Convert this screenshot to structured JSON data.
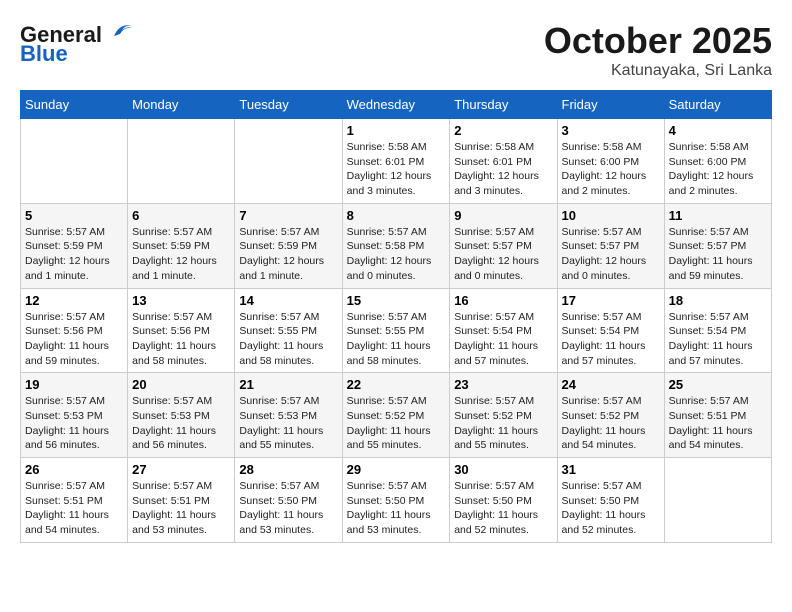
{
  "header": {
    "logo_general": "General",
    "logo_blue": "Blue",
    "month": "October 2025",
    "location": "Katunayaka, Sri Lanka"
  },
  "weekdays": [
    "Sunday",
    "Monday",
    "Tuesday",
    "Wednesday",
    "Thursday",
    "Friday",
    "Saturday"
  ],
  "weeks": [
    [
      {
        "day": "",
        "info": ""
      },
      {
        "day": "",
        "info": ""
      },
      {
        "day": "",
        "info": ""
      },
      {
        "day": "1",
        "info": "Sunrise: 5:58 AM\nSunset: 6:01 PM\nDaylight: 12 hours\nand 3 minutes."
      },
      {
        "day": "2",
        "info": "Sunrise: 5:58 AM\nSunset: 6:01 PM\nDaylight: 12 hours\nand 3 minutes."
      },
      {
        "day": "3",
        "info": "Sunrise: 5:58 AM\nSunset: 6:00 PM\nDaylight: 12 hours\nand 2 minutes."
      },
      {
        "day": "4",
        "info": "Sunrise: 5:58 AM\nSunset: 6:00 PM\nDaylight: 12 hours\nand 2 minutes."
      }
    ],
    [
      {
        "day": "5",
        "info": "Sunrise: 5:57 AM\nSunset: 5:59 PM\nDaylight: 12 hours\nand 1 minute."
      },
      {
        "day": "6",
        "info": "Sunrise: 5:57 AM\nSunset: 5:59 PM\nDaylight: 12 hours\nand 1 minute."
      },
      {
        "day": "7",
        "info": "Sunrise: 5:57 AM\nSunset: 5:59 PM\nDaylight: 12 hours\nand 1 minute."
      },
      {
        "day": "8",
        "info": "Sunrise: 5:57 AM\nSunset: 5:58 PM\nDaylight: 12 hours\nand 0 minutes."
      },
      {
        "day": "9",
        "info": "Sunrise: 5:57 AM\nSunset: 5:57 PM\nDaylight: 12 hours\nand 0 minutes."
      },
      {
        "day": "10",
        "info": "Sunrise: 5:57 AM\nSunset: 5:57 PM\nDaylight: 12 hours\nand 0 minutes."
      },
      {
        "day": "11",
        "info": "Sunrise: 5:57 AM\nSunset: 5:57 PM\nDaylight: 11 hours\nand 59 minutes."
      }
    ],
    [
      {
        "day": "12",
        "info": "Sunrise: 5:57 AM\nSunset: 5:56 PM\nDaylight: 11 hours\nand 59 minutes."
      },
      {
        "day": "13",
        "info": "Sunrise: 5:57 AM\nSunset: 5:56 PM\nDaylight: 11 hours\nand 58 minutes."
      },
      {
        "day": "14",
        "info": "Sunrise: 5:57 AM\nSunset: 5:55 PM\nDaylight: 11 hours\nand 58 minutes."
      },
      {
        "day": "15",
        "info": "Sunrise: 5:57 AM\nSunset: 5:55 PM\nDaylight: 11 hours\nand 58 minutes."
      },
      {
        "day": "16",
        "info": "Sunrise: 5:57 AM\nSunset: 5:54 PM\nDaylight: 11 hours\nand 57 minutes."
      },
      {
        "day": "17",
        "info": "Sunrise: 5:57 AM\nSunset: 5:54 PM\nDaylight: 11 hours\nand 57 minutes."
      },
      {
        "day": "18",
        "info": "Sunrise: 5:57 AM\nSunset: 5:54 PM\nDaylight: 11 hours\nand 57 minutes."
      }
    ],
    [
      {
        "day": "19",
        "info": "Sunrise: 5:57 AM\nSunset: 5:53 PM\nDaylight: 11 hours\nand 56 minutes."
      },
      {
        "day": "20",
        "info": "Sunrise: 5:57 AM\nSunset: 5:53 PM\nDaylight: 11 hours\nand 56 minutes."
      },
      {
        "day": "21",
        "info": "Sunrise: 5:57 AM\nSunset: 5:53 PM\nDaylight: 11 hours\nand 55 minutes."
      },
      {
        "day": "22",
        "info": "Sunrise: 5:57 AM\nSunset: 5:52 PM\nDaylight: 11 hours\nand 55 minutes."
      },
      {
        "day": "23",
        "info": "Sunrise: 5:57 AM\nSunset: 5:52 PM\nDaylight: 11 hours\nand 55 minutes."
      },
      {
        "day": "24",
        "info": "Sunrise: 5:57 AM\nSunset: 5:52 PM\nDaylight: 11 hours\nand 54 minutes."
      },
      {
        "day": "25",
        "info": "Sunrise: 5:57 AM\nSunset: 5:51 PM\nDaylight: 11 hours\nand 54 minutes."
      }
    ],
    [
      {
        "day": "26",
        "info": "Sunrise: 5:57 AM\nSunset: 5:51 PM\nDaylight: 11 hours\nand 54 minutes."
      },
      {
        "day": "27",
        "info": "Sunrise: 5:57 AM\nSunset: 5:51 PM\nDaylight: 11 hours\nand 53 minutes."
      },
      {
        "day": "28",
        "info": "Sunrise: 5:57 AM\nSunset: 5:50 PM\nDaylight: 11 hours\nand 53 minutes."
      },
      {
        "day": "29",
        "info": "Sunrise: 5:57 AM\nSunset: 5:50 PM\nDaylight: 11 hours\nand 53 minutes."
      },
      {
        "day": "30",
        "info": "Sunrise: 5:57 AM\nSunset: 5:50 PM\nDaylight: 11 hours\nand 52 minutes."
      },
      {
        "day": "31",
        "info": "Sunrise: 5:57 AM\nSunset: 5:50 PM\nDaylight: 11 hours\nand 52 minutes."
      },
      {
        "day": "",
        "info": ""
      }
    ]
  ]
}
